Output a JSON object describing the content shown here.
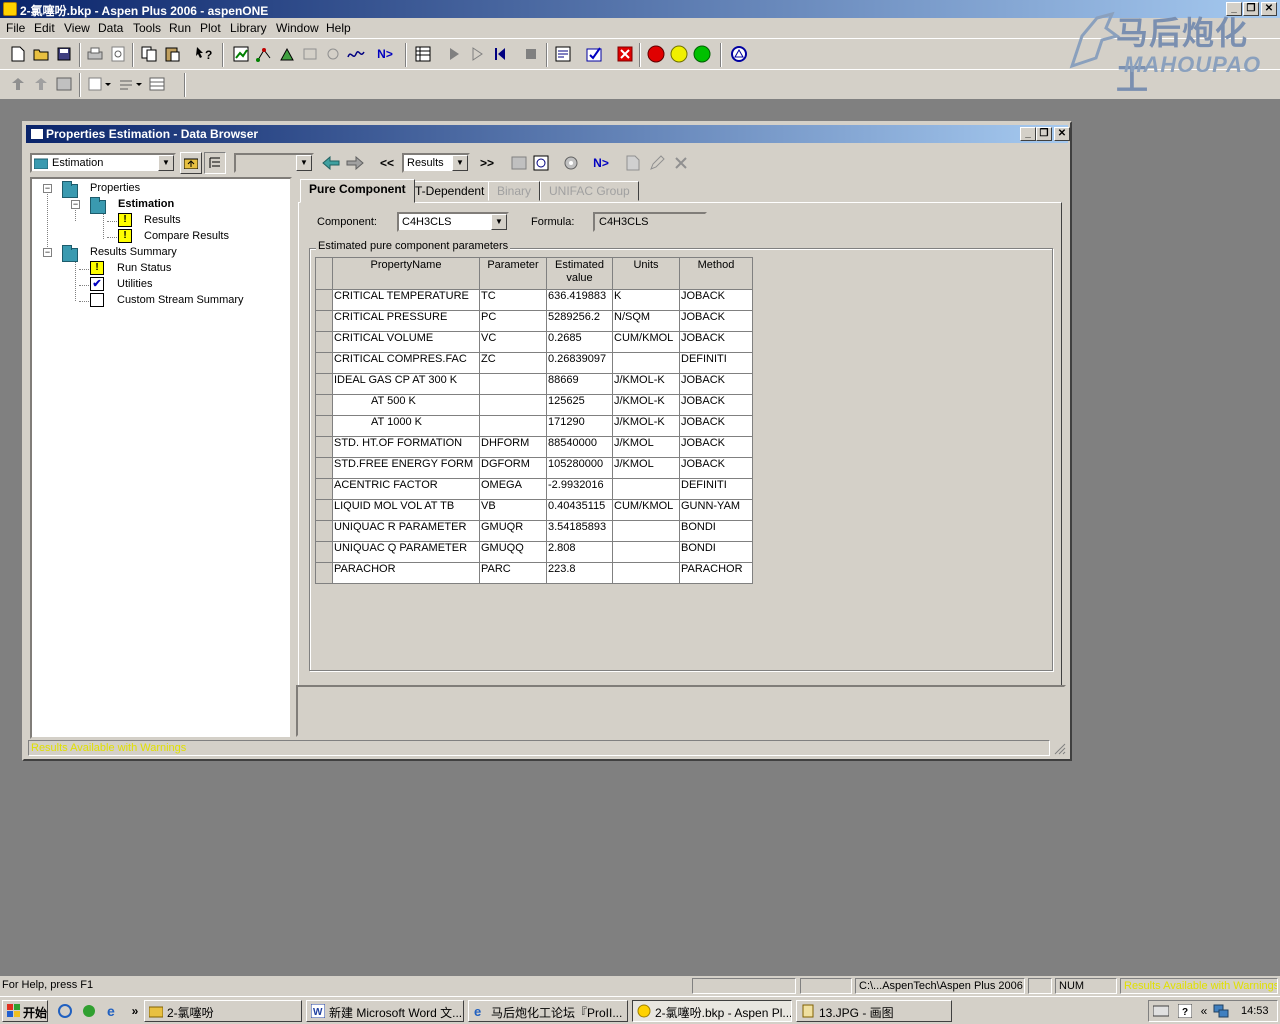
{
  "app": {
    "title": "2-氯噻吩.bkp - Aspen Plus 2006 - aspenONE",
    "min": "_",
    "max": "❐",
    "close": "✕"
  },
  "menu": [
    "File",
    "Edit",
    "View",
    "Data",
    "Tools",
    "Run",
    "Plot",
    "Library",
    "Window",
    "Help"
  ],
  "watermark": {
    "cn": "马后炮化工",
    "en": "MAHOUPAO"
  },
  "browser": {
    "title": "Properties Estimation - Data Browser",
    "folder_combo": "Estimation",
    "form_combo": "Results",
    "prev": "<<",
    "next": ">>",
    "next_icon": "N>"
  },
  "tree": {
    "properties": "Properties",
    "estimation": "Estimation",
    "results": "Results",
    "compare_results": "Compare Results",
    "results_summary": "Results Summary",
    "run_status": "Run Status",
    "utilities": "Utilities",
    "custom_stream_summary": "Custom Stream Summary"
  },
  "tabs": [
    "Pure Component",
    "T-Dependent",
    "Binary",
    "UNIFAC Group"
  ],
  "form": {
    "component_label": "Component:",
    "component_value": "C4H3CLS",
    "formula_label": "Formula:",
    "formula_value": "C4H3CLS",
    "group_label": "Estimated pure component parameters"
  },
  "table": {
    "headers": [
      "PropertyName",
      "Parameter",
      "Estimated value",
      "Units",
      "Method"
    ],
    "rows": [
      [
        "CRITICAL TEMPERATURE",
        "TC",
        "636.419883",
        "K",
        "JOBACK"
      ],
      [
        "CRITICAL PRESSURE",
        "PC",
        "5289256.2",
        "N/SQM",
        "JOBACK"
      ],
      [
        "CRITICAL VOLUME",
        "VC",
        "0.2685",
        "CUM/KMOL",
        "JOBACK"
      ],
      [
        "CRITICAL COMPRES.FAC",
        "ZC",
        "0.26839097",
        "",
        "DEFINITI"
      ],
      [
        "IDEAL GAS CP AT 300 K",
        "",
        "88669",
        "J/KMOL-K",
        "JOBACK"
      ],
      [
        "AT 500 K",
        "",
        "125625",
        "J/KMOL-K",
        "JOBACK"
      ],
      [
        "AT 1000 K",
        "",
        "171290",
        "J/KMOL-K",
        "JOBACK"
      ],
      [
        "STD. HT.OF FORMATION",
        "DHFORM",
        "88540000",
        "J/KMOL",
        "JOBACK"
      ],
      [
        "STD.FREE ENERGY FORM",
        "DGFORM",
        "105280000",
        "J/KMOL",
        "JOBACK"
      ],
      [
        "ACENTRIC FACTOR",
        "OMEGA",
        "-2.9932016",
        "",
        "DEFINITI"
      ],
      [
        "LIQUID MOL VOL AT TB",
        "VB",
        "0.40435115",
        "CUM/KMOL",
        "GUNN-YAM"
      ],
      [
        "UNIQUAC R PARAMETER",
        "GMUQR",
        "3.54185893",
        "",
        "BONDI"
      ],
      [
        "UNIQUAC Q PARAMETER",
        "GMUQQ",
        "2.808",
        "",
        "BONDI"
      ],
      [
        "PARACHOR",
        "PARC",
        "223.8",
        "",
        "PARACHOR"
      ]
    ]
  },
  "browser_status": "Results Available with Warnings",
  "status": {
    "help": "For Help, press F1",
    "path": "C:\\...AspenTech\\Aspen Plus 2006",
    "num": "NUM",
    "warn": "Results Available with Warnings"
  },
  "taskbar": {
    "start": "开始",
    "more": "»",
    "tasks": [
      "2-氯噻吩",
      "新建 Microsoft Word 文...",
      "马后炮化工论坛『ProII...",
      "2-氯噻吩.bkp - Aspen Pl...",
      "13.JPG - 画图"
    ],
    "tray_more": "«",
    "time": "14:53"
  },
  "colors": {
    "titlebar_start": "#0a246a",
    "titlebar_end": "#a6caf0",
    "warning_yellow": "#ffff00",
    "status_warning_text": "#e0e000"
  }
}
